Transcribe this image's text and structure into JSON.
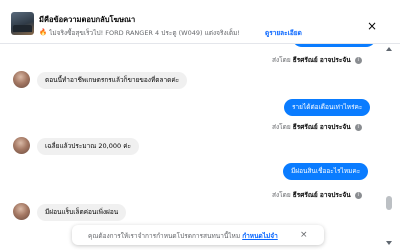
{
  "banner": {
    "title": "มีคือข้อความตอบกลับโฆษณา",
    "flame_icon": "flame-icon",
    "subtitle": "ไม่จริงซื้อสุขเร็วไป! FORD RANGER 4 ประตู (W049) แต่งจริงเต็ม! ค...",
    "link": "ดูรายละเอียด",
    "close": "×"
  },
  "messages": [
    {
      "id": "m0",
      "side": "out",
      "text": ""
    },
    {
      "id": "meta0",
      "type": "meta",
      "prefix": "ส่งโดย",
      "author": "ธีรศรัณย์ อาจประจัน"
    },
    {
      "id": "m1",
      "side": "in",
      "text": "ตอนนี้ทำอาชีพเกษตรกรแล้วก็ขายของที่ตลาดค่ะ"
    },
    {
      "id": "m2",
      "side": "out",
      "text": "รายได้ต่อเดือนเท่าไหร่คะ"
    },
    {
      "id": "meta1",
      "type": "meta",
      "prefix": "ส่งโดย",
      "author": "ธีรศรัณย์ อาจประจัน"
    },
    {
      "id": "m3",
      "side": "in",
      "text": "เฉลี่ยแล้วประมาณ 20,000 ค่ะ"
    },
    {
      "id": "m4",
      "side": "out",
      "text": "มีผ่อนสินเชื่ออะไรไหมคะ"
    },
    {
      "id": "meta2",
      "type": "meta",
      "prefix": "ส่งโดย",
      "author": "ธีรศรัณย์ อาจประจัน"
    },
    {
      "id": "m5",
      "side": "in",
      "text": "มีผ่อนแร็บเล็ตค่อนเพิ่งผ่อน"
    }
  ],
  "cookie": {
    "text": "คุณต้องการให้เราจำการกำหนดโปรดการสนทนานี้ไหม",
    "link": "กำหนดไม่จำ",
    "close": "×"
  }
}
